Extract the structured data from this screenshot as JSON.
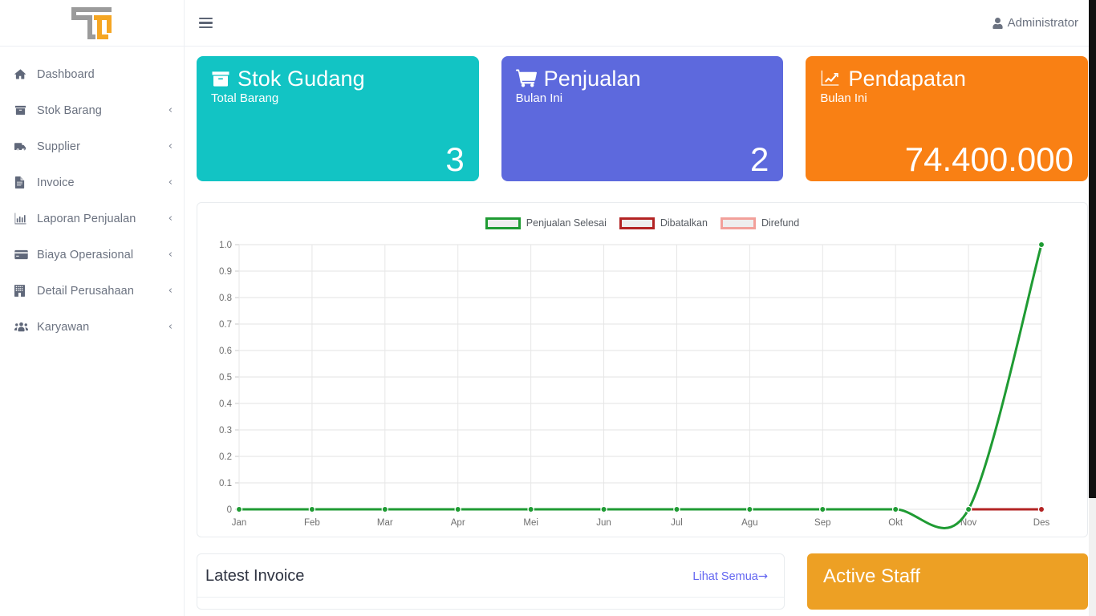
{
  "brand": {
    "logo_icon": "tt-logo"
  },
  "topbar": {
    "menu_icon": "hamburger-icon",
    "user_icon": "user-icon",
    "user_label": "Administrator"
  },
  "sidebar": {
    "items": [
      {
        "label": "Dashboard",
        "icon": "home-icon",
        "caret": "‹",
        "has_caret": false
      },
      {
        "label": "Stok Barang",
        "icon": "box-icon",
        "caret": "‹",
        "has_caret": true
      },
      {
        "label": "Supplier",
        "icon": "truck-icon",
        "caret": "‹",
        "has_caret": true
      },
      {
        "label": "Invoice",
        "icon": "file-icon",
        "caret": "‹",
        "has_caret": true
      },
      {
        "label": "Laporan Penjualan",
        "icon": "bar-chart-icon",
        "caret": "‹",
        "has_caret": true
      },
      {
        "label": "Biaya Operasional",
        "icon": "credit-card-icon",
        "caret": "‹",
        "has_caret": true
      },
      {
        "label": "Detail Perusahaan",
        "icon": "building-icon",
        "caret": "‹",
        "has_caret": true
      },
      {
        "label": "Karyawan",
        "icon": "users-icon",
        "caret": "‹",
        "has_caret": true
      }
    ]
  },
  "stat_cards": [
    {
      "title": "Stok Gudang",
      "subtitle": "Total Barang",
      "value": "3",
      "icon": "box-icon",
      "color": "#12c4c4"
    },
    {
      "title": "Penjualan",
      "subtitle": "Bulan Ini",
      "value": "2",
      "icon": "cart-icon",
      "color": "#5d69dd"
    },
    {
      "title": "Pendapatan",
      "subtitle": "Bulan Ini",
      "value": "74.400.000",
      "icon": "trend-up-icon",
      "color": "#f98014"
    }
  ],
  "chart_data": {
    "type": "line",
    "title": "",
    "xlabel": "",
    "ylabel": "",
    "categories": [
      "Jan",
      "Feb",
      "Mar",
      "Apr",
      "Mei",
      "Jun",
      "Jul",
      "Agu",
      "Sep",
      "Okt",
      "Nov",
      "Des"
    ],
    "ylim": [
      0,
      1.0
    ],
    "ytick_labels": [
      "0",
      "0.1",
      "0.2",
      "0.3",
      "0.4",
      "0.5",
      "0.6",
      "0.7",
      "0.8",
      "0.9",
      "1.0"
    ],
    "ytick_values": [
      0,
      0.1,
      0.2,
      0.3,
      0.4,
      0.5,
      0.6,
      0.7,
      0.8,
      0.9,
      1.0
    ],
    "grid": true,
    "legend_position": "top-center",
    "series": [
      {
        "name": "Penjualan Selesai",
        "color": "#1f9b33",
        "values": [
          0,
          0,
          0,
          0,
          0,
          0,
          0,
          0,
          0,
          0,
          0,
          1.0
        ]
      },
      {
        "name": "Dibatalkan",
        "color": "#b32424",
        "values": [
          null,
          null,
          null,
          null,
          null,
          null,
          null,
          null,
          null,
          null,
          0,
          0
        ]
      },
      {
        "name": "Direfund",
        "color": "#f2a09a",
        "values": [
          null,
          null,
          null,
          null,
          null,
          null,
          null,
          null,
          null,
          null,
          null,
          null
        ]
      }
    ]
  },
  "latest_invoice": {
    "title": "Latest Invoice",
    "see_all_label": "Lihat Semua",
    "see_all_arrow": "→"
  },
  "active_staff": {
    "title": "Active Staff",
    "color": "#eda024"
  },
  "scrollbar": {
    "thumb_position": "top"
  }
}
